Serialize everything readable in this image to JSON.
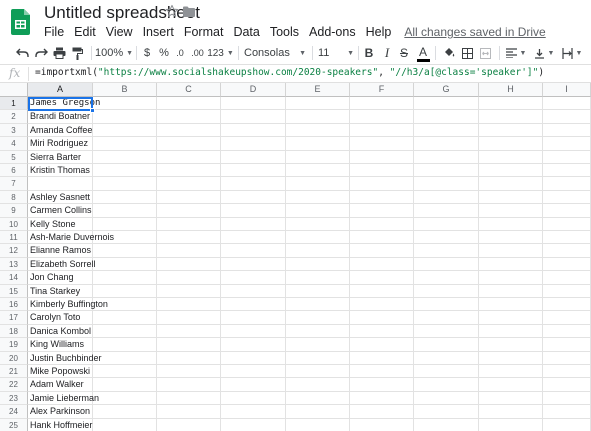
{
  "doc": {
    "title": "Untitled spreadsheet",
    "saved_status": "All changes saved in Drive"
  },
  "menu": [
    "File",
    "Edit",
    "View",
    "Insert",
    "Format",
    "Data",
    "Tools",
    "Add-ons",
    "Help"
  ],
  "toolbar": {
    "zoom": "100%",
    "currency": "$",
    "percent": "%",
    "decrease_decimals": ".0",
    "increase_decimals": ".00",
    "more_formats": "123",
    "font": "Consolas",
    "font_size": "11",
    "bold": "B",
    "italic": "I",
    "strikethrough": "S",
    "text_color_letter": "A"
  },
  "formula_bar": {
    "fx_label": "fx",
    "prefix": "=importxml(",
    "url_arg": "\"https://www.socialshakeupshow.com/2020-speakers\"",
    "sep": ", ",
    "xpath_arg": "\"//h3/a[@class='speaker']\"",
    "suffix": ")"
  },
  "grid": {
    "columns": [
      "A",
      "B",
      "C",
      "D",
      "E",
      "F",
      "G",
      "H",
      "I"
    ],
    "rows": [
      "1",
      "2",
      "3",
      "4",
      "5",
      "6",
      "7",
      "8",
      "9",
      "10",
      "11",
      "12",
      "13",
      "14",
      "15",
      "16",
      "17",
      "18",
      "19",
      "20",
      "21",
      "22",
      "23",
      "24",
      "25"
    ],
    "active_cell": "A1",
    "column_a": [
      "James Gregson",
      "Brandi Boatner",
      "Amanda Coffee",
      "Miri Rodriguez",
      "Sierra Barter",
      "Kristin Thomas",
      "",
      "Ashley Sasnett",
      "Carmen Collins",
      "Kelly Stone",
      "Ash-Marie Duvernois",
      "Elianne Ramos",
      "Elizabeth Sorrell",
      "Jon Chang",
      "Tina Starkey",
      "Kimberly Buffington",
      "Carolyn Toto",
      "Danica Kombol",
      "King Williams",
      "Justin Buchbinder",
      "Mike Popowski",
      "Adam Walker",
      "Jamie Lieberman",
      "Alex Parkinson",
      "Hank Hoffmeier"
    ]
  },
  "colors": {
    "accent": "#1a73e8",
    "sheets_green": "#0f9d58",
    "formula_string": "#0b8043"
  },
  "icons": [
    "sheets-logo",
    "star",
    "folder",
    "undo",
    "redo",
    "print",
    "paint-format",
    "fill-color",
    "borders",
    "merge",
    "align-left",
    "valign",
    "text-wrap",
    "fx"
  ]
}
